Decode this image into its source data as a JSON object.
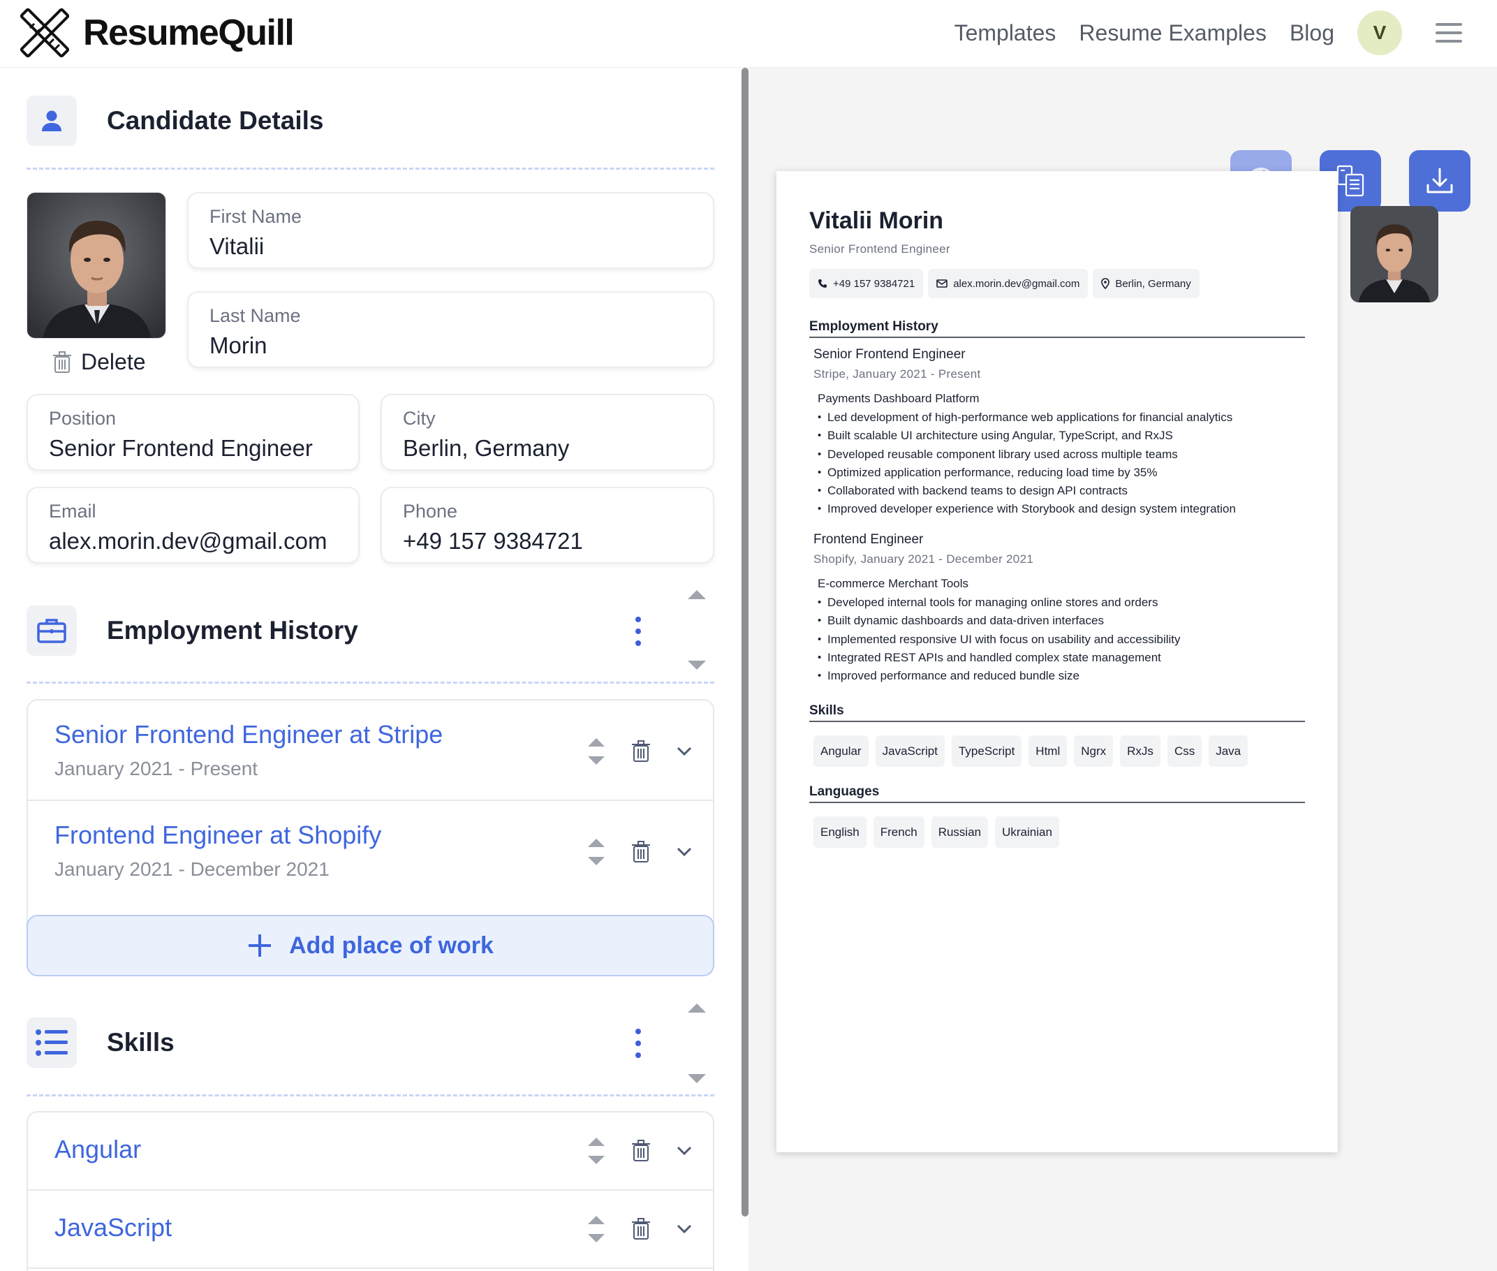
{
  "app": {
    "brand": "ResumeQuill"
  },
  "nav": {
    "links": [
      "Templates",
      "Resume Examples",
      "Blog"
    ],
    "avatar_initial": "V"
  },
  "candidate": {
    "section_title": "Candidate Details",
    "delete_label": "Delete",
    "first_name": {
      "label": "First Name",
      "value": "Vitalii"
    },
    "last_name": {
      "label": "Last Name",
      "value": "Morin"
    },
    "position": {
      "label": "Position",
      "value": "Senior Frontend Engineer"
    },
    "city": {
      "label": "City",
      "value": "Berlin, Germany"
    },
    "email": {
      "label": "Email",
      "value": "alex.morin.dev@gmail.com"
    },
    "phone": {
      "label": "Phone",
      "value": "+49 157 9384721"
    }
  },
  "employment": {
    "section_title": "Employment History",
    "items": [
      {
        "title": "Senior Frontend Engineer at Stripe",
        "dates": "January 2021 - Present"
      },
      {
        "title": "Frontend Engineer at Shopify",
        "dates": "January 2021 - December 2021"
      }
    ],
    "add_label": "Add place of work"
  },
  "skills": {
    "section_title": "Skills",
    "items": [
      "Angular",
      "JavaScript"
    ]
  },
  "toolbar": {
    "buttons": [
      "palette-icon",
      "template-icon",
      "download-icon"
    ]
  },
  "preview": {
    "name": "Vitalii Morin",
    "position": "Senior Frontend Engineer",
    "phone": "+49 157 9384721",
    "email": "alex.morin.dev@gmail.com",
    "location": "Berlin, Germany",
    "employment_heading": "Employment History",
    "jobs": [
      {
        "title": "Senior Frontend Engineer",
        "meta": "Stripe, January 2021 - Present",
        "project": "Payments Dashboard Platform",
        "bullets": [
          "Led development of high-performance web applications for financial analytics",
          "Built scalable UI architecture using Angular, TypeScript, and RxJS",
          "Developed reusable component library used across multiple teams",
          "Optimized application performance, reducing load time by 35%",
          "Collaborated with backend teams to design API contracts",
          "Improved developer experience with Storybook and design system integration"
        ]
      },
      {
        "title": "Frontend Engineer",
        "meta": "Shopify, January 2021 - December 2021",
        "project": "E-commerce Merchant Tools",
        "bullets": [
          "Developed internal tools for managing online stores and orders",
          "Built dynamic dashboards and data-driven interfaces",
          "Implemented responsive UI with focus on usability and accessibility",
          "Integrated REST APIs and handled complex state management",
          "Improved performance and reduced bundle size"
        ]
      }
    ],
    "skills_heading": "Skills",
    "skills": [
      "Angular",
      "JavaScript",
      "TypeScript",
      "Html",
      "Ngrx",
      "RxJs",
      "Css",
      "Java"
    ],
    "languages_heading": "Languages",
    "languages": [
      "English",
      "French",
      "Russian",
      "Ukrainian"
    ]
  },
  "colors": {
    "accent": "#3f66de",
    "toolbar_button": "#4f6fd8",
    "palette_button": "#98aaea",
    "avatar_bg": "#e3ecc3"
  }
}
